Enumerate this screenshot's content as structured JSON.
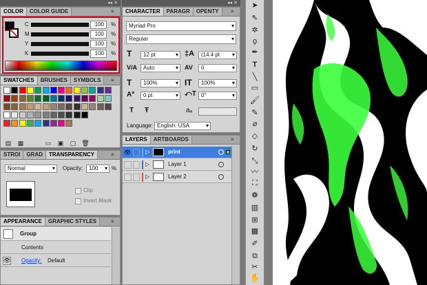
{
  "color_panel": {
    "tabs": [
      "COLOR",
      "COLOR GUIDE"
    ],
    "channels": [
      {
        "label": "C",
        "value": "100",
        "unit": "%"
      },
      {
        "label": "M",
        "value": "100",
        "unit": "%"
      },
      {
        "label": "Y",
        "value": "100",
        "unit": "%"
      },
      {
        "label": "K",
        "value": "100",
        "unit": "%"
      }
    ]
  },
  "swatches_panel": {
    "tabs": [
      "SWATCHES",
      "BRUSHES",
      "SYMBOLS"
    ],
    "row1": [
      "#ffffff",
      "#000000",
      "#ff0000",
      "#ffff00",
      "#00a651",
      "#00aeef",
      "#0000ff",
      "#ec008c",
      "#f26522",
      "#fff200",
      "#8dc63f",
      "#00a99d",
      "#2e3192",
      "#662d91"
    ],
    "row2": [
      "#9e0b0f",
      "#a0410d",
      "#8c6239",
      "#598527",
      "#007236",
      "#005e20",
      "#0076a3",
      "#003471",
      "#1b1464",
      "#440e62",
      "#630460",
      "#9e005d",
      "#a3d39c",
      "#7accc8"
    ],
    "row3": [
      "#754c24",
      "#8c6239",
      "#a67c52",
      "#c69c6d",
      "#d8b98b",
      "#c0a07a",
      "#9b8579",
      "#7d6b5f",
      "#534741",
      "#362f2d",
      "#c7b299",
      "#998675",
      "#736357",
      "#534741"
    ],
    "row4": [
      "#ffffff",
      "#e6e6e6",
      "#cccccc",
      "#b3b3b3",
      "#999999",
      "#808080",
      "#666666",
      "#4d4d4d",
      "#333333",
      "#1a1a1a",
      "#000000"
    ],
    "row5": [
      "#ed1c24",
      "#f7941d",
      "#fff200",
      "#39b54a",
      "#00aeef",
      "#2e3192",
      "#92278f",
      "#ec008c",
      "#a67c52"
    ]
  },
  "stroke_panel": {
    "tabs": [
      "STROI",
      "GRAD",
      "TRANSPARENCY"
    ],
    "blend_mode": "Normal",
    "opacity_label": "Opacity:",
    "opacity_value": "100",
    "opacity_unit": "%",
    "clip_label": "Clip",
    "invert_mask_label": "Invert Mask"
  },
  "appearance_panel": {
    "tabs": [
      "APPEARANCE",
      "GRAPHIC STYLES"
    ],
    "group_label": "Group",
    "contents_label": "Contents",
    "opacity_link": "Opacity:",
    "opacity_value": "Default"
  },
  "character_panel": {
    "tabs": [
      "CHARACTER",
      "PARAGR",
      "OPENTY"
    ],
    "font_family": "Myriad Pro",
    "font_style": "Regular",
    "font_size": "12 pt",
    "leading": "(14.4 pt",
    "kerning": "Auto",
    "tracking": "0",
    "vertical_scale": "100%",
    "horizontal_scale": "100%",
    "baseline_shift": "0 pt",
    "rotation": "0°",
    "language_label": "Language:",
    "language_value": "English: USA"
  },
  "layers_panel": {
    "tabs": [
      "LAYERS",
      "ARTBOARDS"
    ],
    "layers": [
      {
        "name": "print",
        "color": "#4fb3ff"
      },
      {
        "name": "Layer 1",
        "color": "#3d6ad6"
      },
      {
        "name": "Layer 2",
        "color": "#e04848"
      }
    ]
  },
  "colors": {
    "canvas_bg": "#000000",
    "artwork_white": "#ffffff",
    "artwork_green": "#3cff3c",
    "selection": "#3d7ee0",
    "highlight_red": "#d9001b"
  }
}
